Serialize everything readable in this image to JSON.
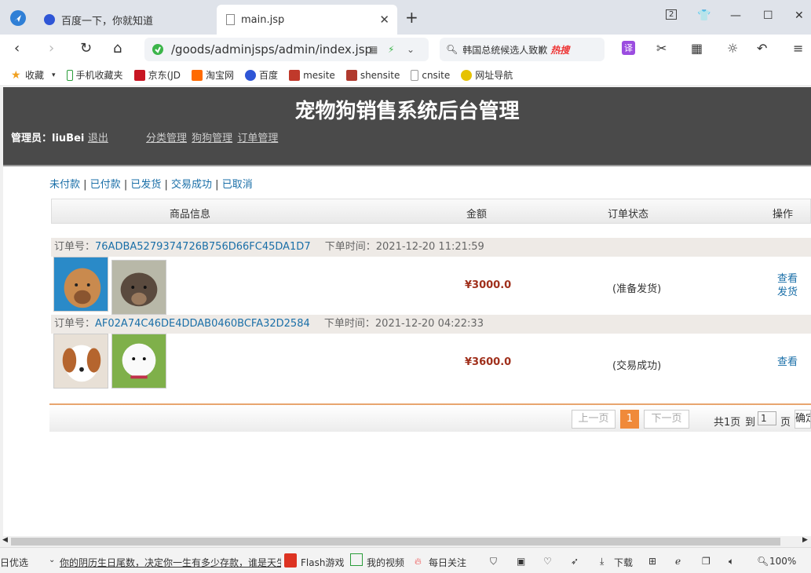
{
  "browser": {
    "tabs": [
      {
        "title": "百度一下，你就知道"
      },
      {
        "title": "main.jsp"
      }
    ],
    "tab_counter": "2",
    "url": "/goods/adminjsps/admin/index.jsp",
    "search_hint": "韩国总统候选人致歉",
    "search_hot": "热搜",
    "translate_label": "译",
    "bookmarks": [
      "收藏",
      "手机收藏夹",
      "京东(JD",
      "淘宝网",
      "百度",
      "mesite",
      "shensite",
      "cnsite",
      "网址导航"
    ]
  },
  "site": {
    "title": "宠物狗销售系统后台管理",
    "admin_label": "管理员：",
    "admin_name": "liuBei",
    "logout": "退出",
    "nav": [
      "分类管理",
      "狗狗管理",
      "订单管理"
    ]
  },
  "filters": [
    "未付款",
    "已付款",
    "已发货",
    "交易成功",
    "已取消"
  ],
  "table_headers": [
    "商品信息",
    "金额",
    "订单状态",
    "操作"
  ],
  "orders": [
    {
      "label": "订单号：",
      "id": "76ADBA5279374726B756D66FC45DA1D7",
      "time_label": "下单时间：",
      "time": "2021-12-20 11:21:59",
      "amount": "¥3000.0",
      "status": "(准备发货)",
      "ops": [
        "查看",
        "发货"
      ]
    },
    {
      "label": "订单号：",
      "id": "AF02A74C46DE4DDAB0460BCFA32D2584",
      "time_label": "下单时间：",
      "time": "2021-12-20 04:22:33",
      "amount": "¥3600.0",
      "status": "(交易成功)",
      "ops": [
        "查看"
      ]
    }
  ],
  "pager": {
    "prev": "上一页",
    "current": "1",
    "next": "下一页",
    "total": "共1页",
    "goto": "到",
    "page_value": "1",
    "page_unit": "页",
    "confirm": "确定"
  },
  "statusbar": {
    "left": "日优选",
    "news": "你的阴历生日尾数，决定你一生有多少存款，谁是天生",
    "flash": "Flash游戏",
    "video": "我的视频",
    "daily": "每日关注",
    "download": "下载",
    "zoom": "100%"
  },
  "colors": {
    "header_bg": "#4a4a4a",
    "link": "#1a6fa8",
    "accent": "#f08a3a",
    "amount": "#a0301c"
  }
}
